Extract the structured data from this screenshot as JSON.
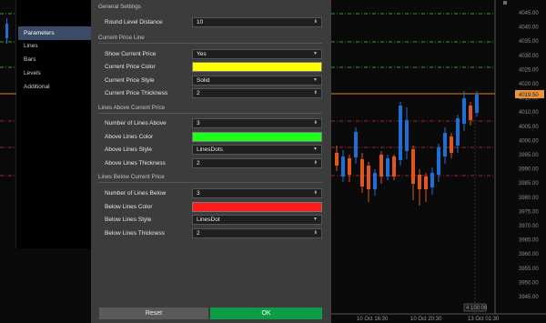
{
  "sidebar": {
    "items": [
      {
        "label": "Parameters",
        "active": true
      },
      {
        "label": "Lines",
        "active": false
      },
      {
        "label": "Bars",
        "active": false
      },
      {
        "label": "Levels",
        "active": false
      },
      {
        "label": "Additional",
        "active": false
      }
    ]
  },
  "dialog": {
    "general": {
      "title": "General Settings",
      "round_level_label": "Round Level Distance",
      "round_level_value": "10"
    },
    "current_price": {
      "title": "Current Price Line",
      "show_label": "Show Current Price",
      "show_value": "Yes",
      "color_label": "Current Price Color",
      "color_value": "#ffff00",
      "style_label": "Current Price Style",
      "style_value": "Solid",
      "thickness_label": "Current Price Thickness",
      "thickness_value": "2"
    },
    "above": {
      "title": "Lines Above Current Price",
      "count_label": "Number of Lines Above",
      "count_value": "3",
      "color_label": "Above Lines Color",
      "color_value": "#1bff1b",
      "style_label": "Above Lines Style",
      "style_value": "LinesDots",
      "thickness_label": "Above Lines Thickness",
      "thickness_value": "2"
    },
    "below": {
      "title": "Lines Below Current Price",
      "count_label": "Number of Lines Below",
      "count_value": "3",
      "color_label": "Below Lines Color",
      "color_value": "#ff1a1a",
      "style_label": "Below Lines Style",
      "style_value": "LinesDot",
      "thickness_label": "Below Lines Thickness",
      "thickness_value": "2"
    },
    "buttons": {
      "reset": "Reset",
      "ok": "OK"
    }
  },
  "chart": {
    "price_labels": [
      "4045.00",
      "4040.00",
      "4035.00",
      "4030.00",
      "4025.00",
      "4020.00",
      "4015.00",
      "4010.00",
      "4005.00",
      "4000.00",
      "3995.00",
      "3990.00",
      "3985.00",
      "3980.00",
      "3975.00",
      "3970.00",
      "3965.00",
      "3960.00",
      "3955.00",
      "3950.00",
      "3945.00"
    ],
    "current_price_tag": "4019.50",
    "time_labels": [
      "10 Oct 16:30",
      "10 Oct 20:30",
      "13 Oct 01:30"
    ],
    "cursor_tag": "4 100:00",
    "colors": {
      "up": "#1e6fd4",
      "down": "#e0561f",
      "above_line": "#3ccf3c",
      "below_line": "#c73333",
      "current_line": "#d9822b"
    }
  }
}
